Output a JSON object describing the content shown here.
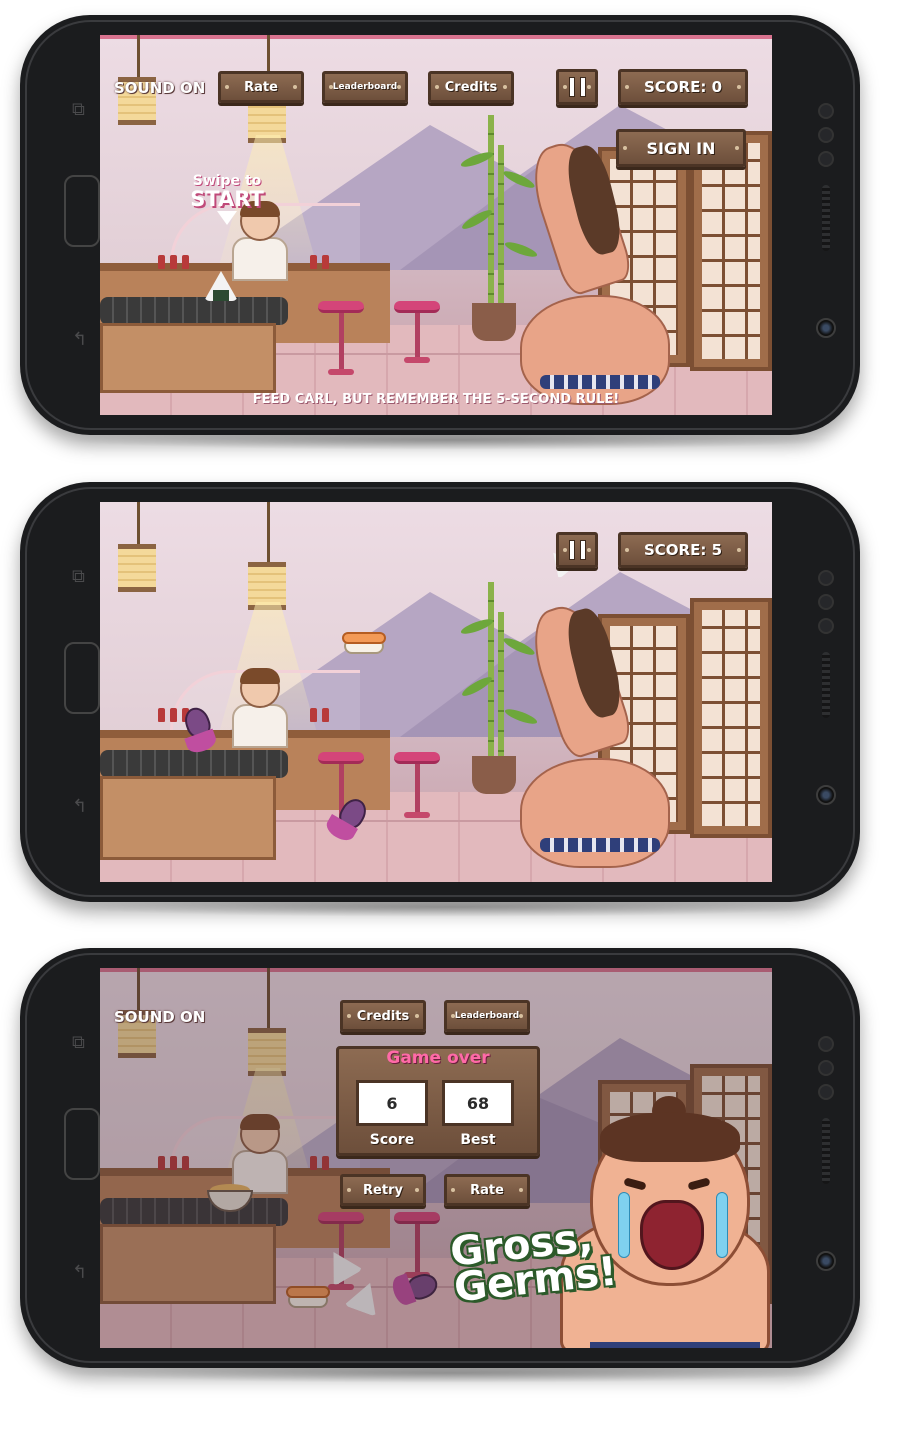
{
  "screens": [
    {
      "sound_label": "SOUND ON",
      "buttons": {
        "rate": "Rate",
        "leaderboard": "Leaderboard",
        "credits": "Credits",
        "sign_in": "SIGN IN"
      },
      "score_label": "SCORE: 0",
      "swipe_hint_small": "Swipe to",
      "swipe_hint_big": "START",
      "tip": "FEED CARL, BUT REMEMBER THE 5-SECOND RULE!"
    },
    {
      "score_label": "SCORE: 5"
    },
    {
      "sound_label": "SOUND ON",
      "buttons": {
        "credits": "Credits",
        "leaderboard": "Leaderboard",
        "retry": "Retry",
        "rate": "Rate"
      },
      "game_over": "Game over",
      "score_value": "6",
      "best_value": "68",
      "score_caption": "Score",
      "best_caption": "Best",
      "exclaim_line1": "Gross,",
      "exclaim_line2": "Germs!"
    }
  ],
  "icons": [
    "pause-icon",
    "home-button",
    "back-icon",
    "recents-icon",
    "front-camera-icon"
  ],
  "colors": {
    "wood": "#6d4f3b",
    "accent_pink": "#ff6aa8",
    "stool": "#d44579",
    "bg_pink": "#e9d4df"
  }
}
